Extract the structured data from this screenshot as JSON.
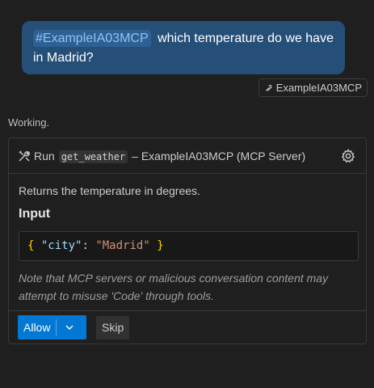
{
  "message": {
    "mention": "#ExampleIA03MCP",
    "text": "which temperature do we have in Madrid?"
  },
  "reference_chip": {
    "icon": "tools-reference-icon",
    "label": "ExampleIA03MCP"
  },
  "status": "Working.",
  "tool_card": {
    "run_label": "Run",
    "tool_name": "get_weather",
    "tool_source": "– ExampleIA03MCP (MCP Server)",
    "description": "Returns the temperature in degrees.",
    "input_title": "Input",
    "input_code": {
      "open": "{",
      "key": "\"city\"",
      "colon": ":",
      "value": "\"Madrid\"",
      "close": "}"
    },
    "note": "Note that MCP servers or malicious conversation content may attempt to misuse 'Code' through tools.",
    "allow_label": "Allow",
    "skip_label": "Skip"
  },
  "colors": {
    "accent": "#0078d4",
    "bubble": "#264f78",
    "background": "#1f1f1f"
  }
}
